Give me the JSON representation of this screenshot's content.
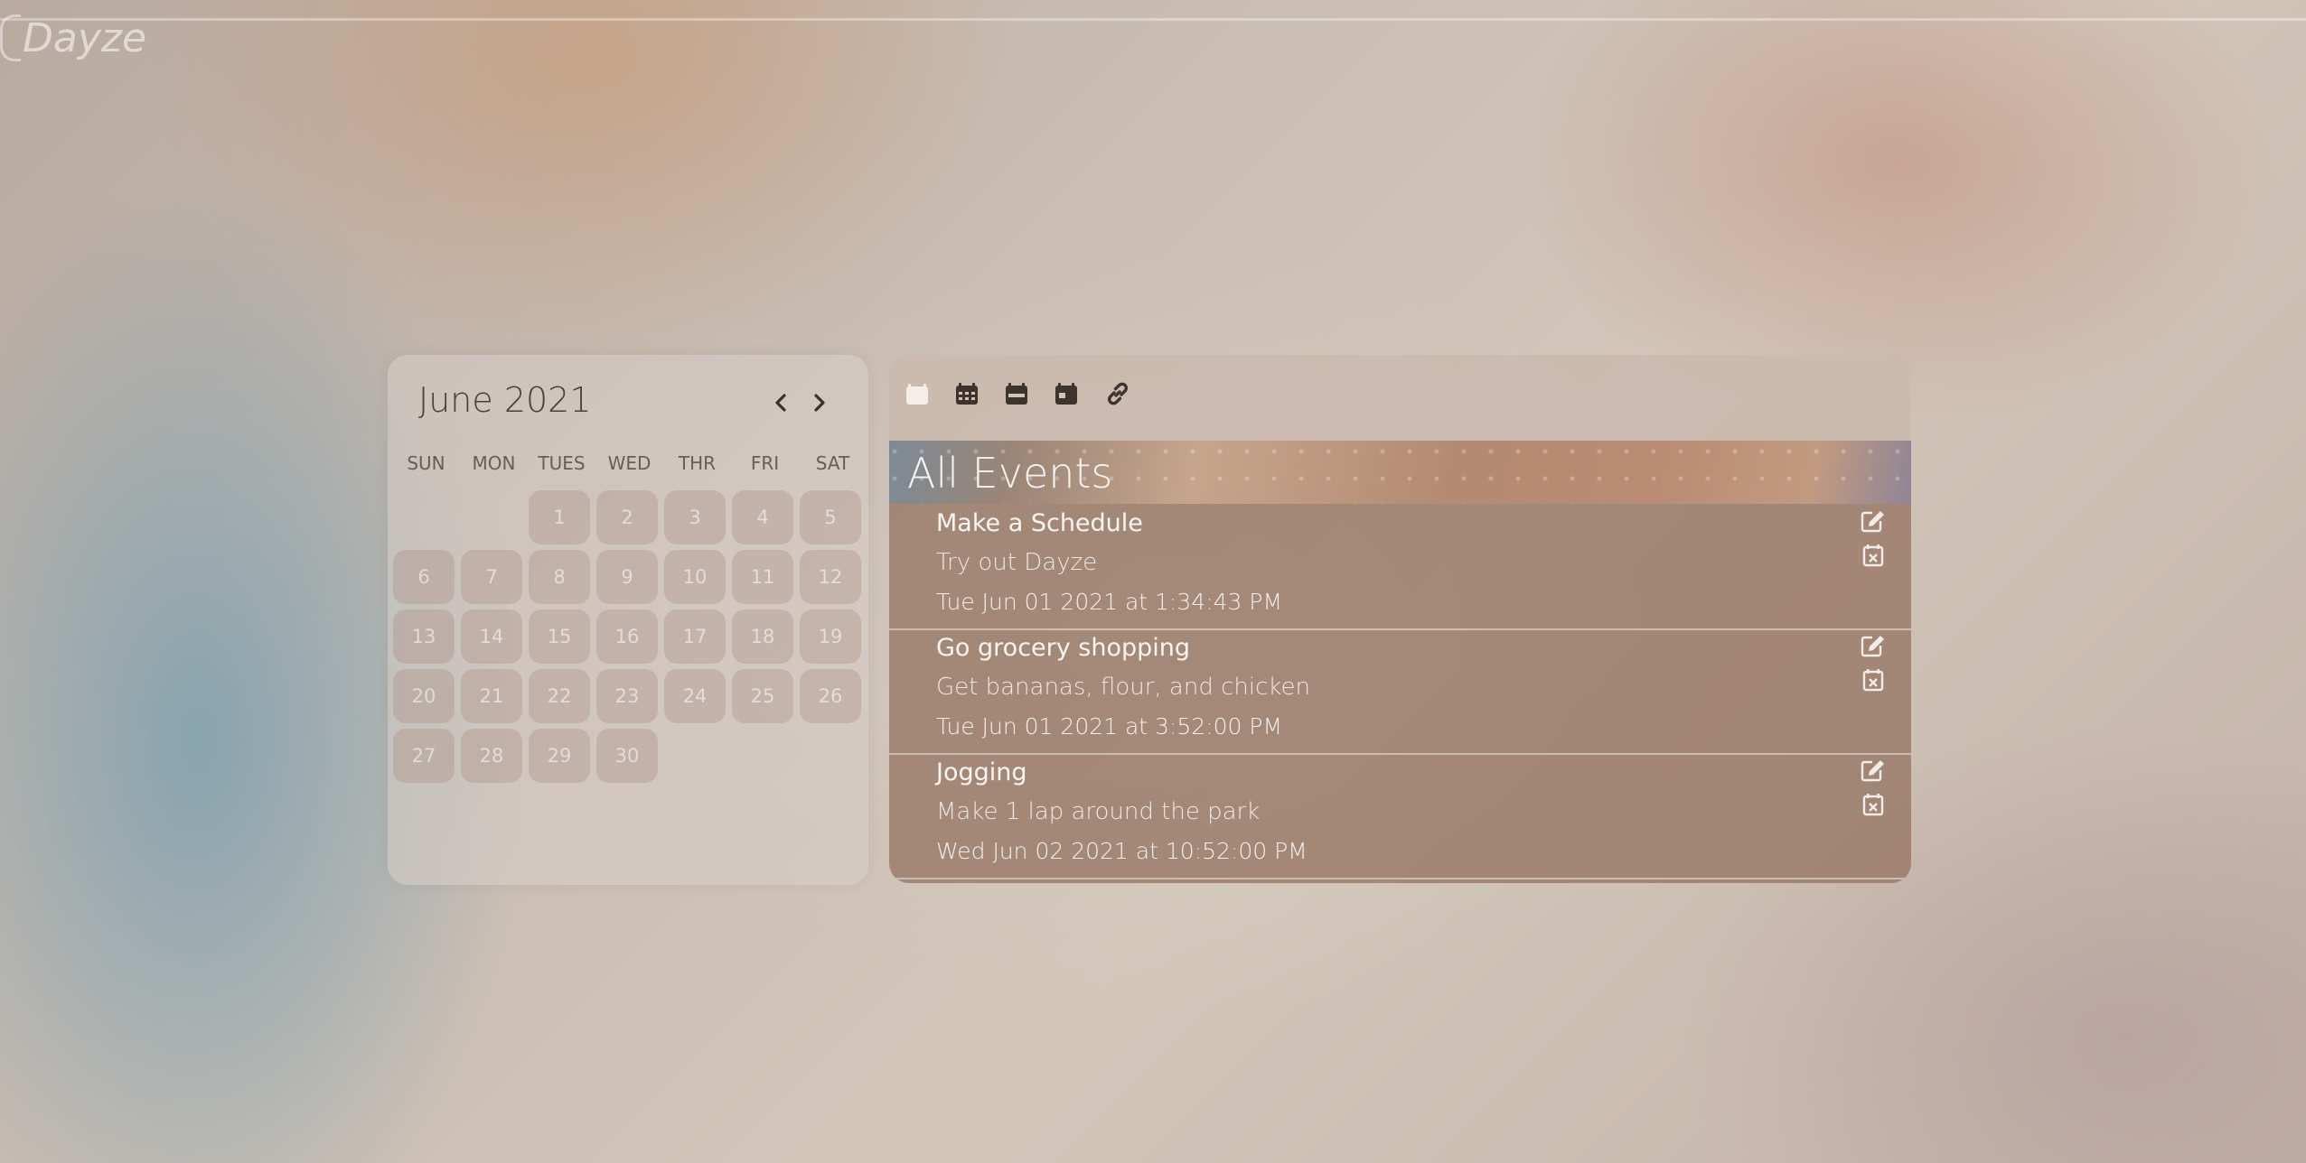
{
  "app": {
    "brand": "Dayze"
  },
  "calendar": {
    "month_label": "June 2021",
    "weekdays": [
      "SUN",
      "MON",
      "TUES",
      "WED",
      "THR",
      "FRI",
      "SAT"
    ],
    "days": [
      "",
      "",
      "1",
      "2",
      "3",
      "4",
      "5",
      "6",
      "7",
      "8",
      "9",
      "10",
      "11",
      "12",
      "13",
      "14",
      "15",
      "16",
      "17",
      "18",
      "19",
      "20",
      "21",
      "22",
      "23",
      "24",
      "25",
      "26",
      "27",
      "28",
      "29",
      "30",
      "",
      "",
      ""
    ]
  },
  "toolbar": {
    "icons": [
      "calendar-day-icon",
      "calendar-month-icon",
      "calendar-week-icon",
      "calendar-today-icon",
      "link-icon"
    ]
  },
  "events_panel": {
    "title": "All Events",
    "events": [
      {
        "title": "Make a Schedule",
        "description": "Try out Dayze",
        "time": "Tue Jun 01 2021 at 1:34:43 PM"
      },
      {
        "title": "Go grocery shopping",
        "description": "Get bananas, flour, and chicken",
        "time": "Tue Jun 01 2021 at 3:52:00 PM"
      },
      {
        "title": "Jogging",
        "description": "Make 1 lap around the park",
        "time": "Wed Jun 02 2021 at 10:52:00 PM"
      }
    ]
  },
  "colors": {
    "calendar_text": "#4b3f39",
    "event_panel": "#96765f",
    "toolbar_icon": "#3f332d"
  }
}
